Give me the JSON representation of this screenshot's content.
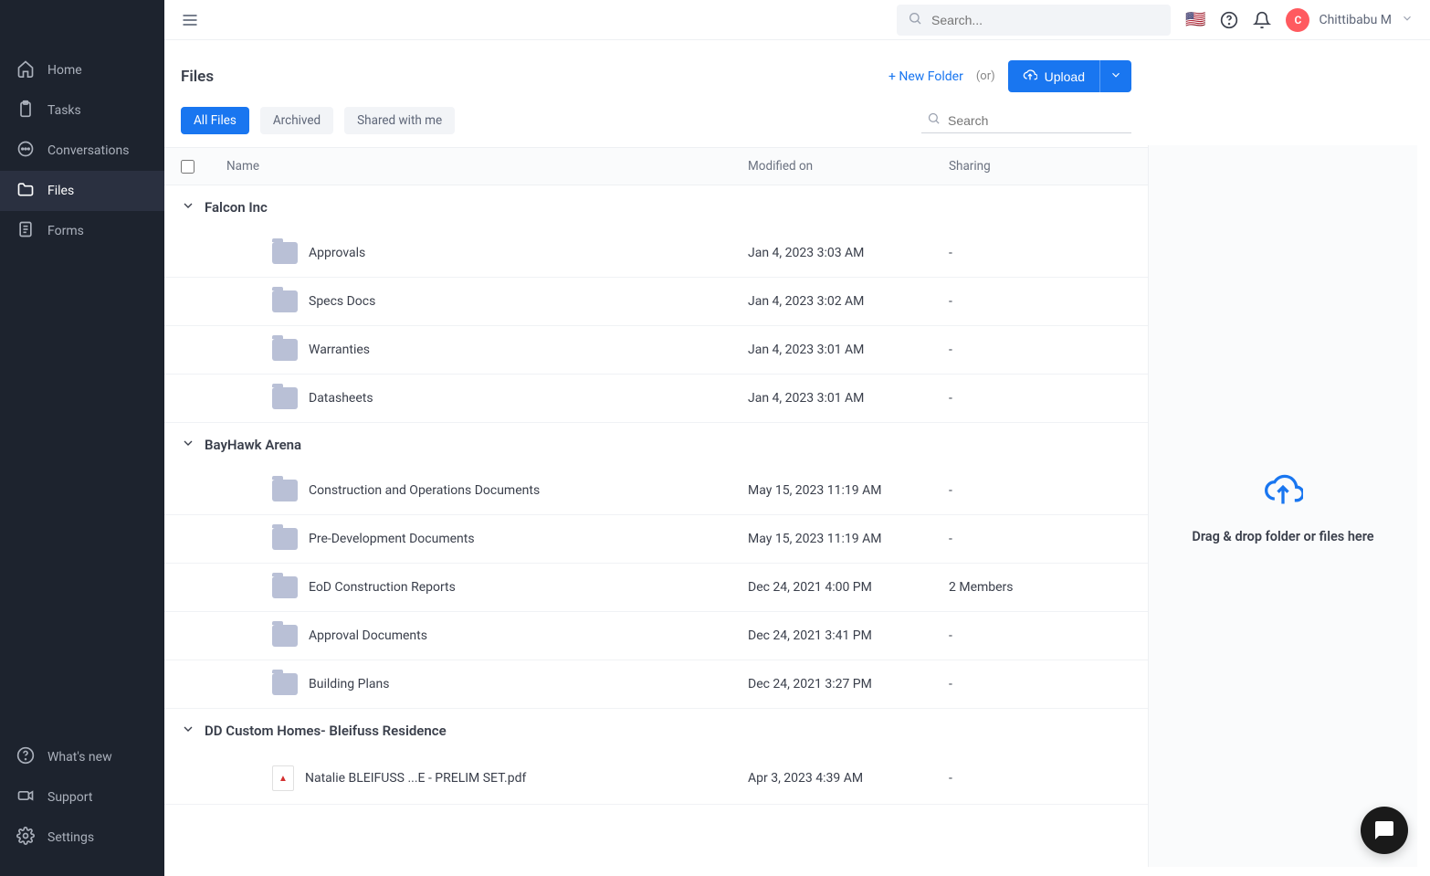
{
  "sidebar": {
    "top": [
      {
        "label": "Home",
        "icon": "home"
      },
      {
        "label": "Tasks",
        "icon": "clipboard"
      },
      {
        "label": "Conversations",
        "icon": "chat"
      },
      {
        "label": "Files",
        "icon": "folder",
        "active": true
      },
      {
        "label": "Forms",
        "icon": "form"
      }
    ],
    "bottom": [
      {
        "label": "What's new",
        "icon": "help"
      },
      {
        "label": "Support",
        "icon": "video"
      },
      {
        "label": "Settings",
        "icon": "gear"
      }
    ]
  },
  "topbar": {
    "search_placeholder": "Search...",
    "user_name": "Chittibabu M",
    "user_initial": "C"
  },
  "page": {
    "title": "Files",
    "new_folder": "+ New Folder",
    "or": "(or)",
    "upload": "Upload"
  },
  "tabs": [
    {
      "label": "All Files",
      "active": true
    },
    {
      "label": "Archived"
    },
    {
      "label": "Shared with me"
    }
  ],
  "local_search_placeholder": "Search",
  "columns": {
    "name": "Name",
    "modified": "Modified on",
    "sharing": "Sharing"
  },
  "groups": [
    {
      "name": "Falcon Inc",
      "rows": [
        {
          "type": "folder",
          "name": "Approvals",
          "modified": "Jan 4, 2023 3:03 AM",
          "sharing": "-"
        },
        {
          "type": "folder",
          "name": "Specs Docs",
          "modified": "Jan 4, 2023 3:02 AM",
          "sharing": "-"
        },
        {
          "type": "folder",
          "name": "Warranties",
          "modified": "Jan 4, 2023 3:01 AM",
          "sharing": "-"
        },
        {
          "type": "folder",
          "name": "Datasheets",
          "modified": "Jan 4, 2023 3:01 AM",
          "sharing": "-"
        }
      ]
    },
    {
      "name": "BayHawk Arena",
      "rows": [
        {
          "type": "folder",
          "name": "Construction and Operations Documents",
          "modified": "May 15, 2023 11:19 AM",
          "sharing": "-"
        },
        {
          "type": "folder",
          "name": "Pre-Development Documents",
          "modified": "May 15, 2023 11:19 AM",
          "sharing": "-"
        },
        {
          "type": "folder",
          "name": "EoD Construction Reports",
          "modified": "Dec 24, 2021 4:00 PM",
          "sharing": "2 Members"
        },
        {
          "type": "folder",
          "name": "Approval Documents",
          "modified": "Dec 24, 2021 3:41 PM",
          "sharing": "-"
        },
        {
          "type": "folder",
          "name": "Building Plans",
          "modified": "Dec 24, 2021 3:27 PM",
          "sharing": "-"
        }
      ]
    },
    {
      "name": "DD Custom Homes- Bleifuss Residence",
      "rows": [
        {
          "type": "pdf",
          "name": "Natalie BLEIFUSS ...E - PRELIM SET.pdf",
          "modified": "Apr 3, 2023 4:39 AM",
          "sharing": "-"
        }
      ]
    }
  ],
  "drop_text": "Drag & drop folder or files here"
}
